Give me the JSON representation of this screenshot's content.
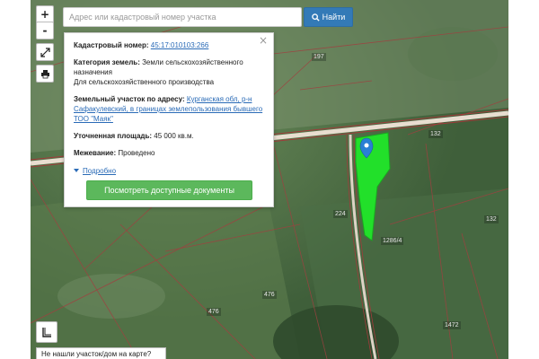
{
  "search": {
    "placeholder": "Адрес или кадастровый номер участка",
    "button_label": "Найти"
  },
  "zoom": {
    "in_label": "+",
    "out_label": "-"
  },
  "popup": {
    "cadastral_label": "Кадастровый номер:",
    "cadastral_value": "45:17:010103:266",
    "category_label": "Категория земель:",
    "category_value_1": "Земли сельскохозяйственного назначения",
    "category_value_2": "Для сельскохозяйственного производства",
    "address_label": "Земельный участок по адресу:",
    "address_value": "Курганская обл, р-н Сафакулевский, в границах землепользования бывшего ТОО \"Маяк\"",
    "area_label": "Уточненная площадь:",
    "area_value": "45 000 кв.м.",
    "survey_label": "Межевание:",
    "survey_value": "Проведено",
    "more_label": "Подробно",
    "docs_button": "Посмотреть доступные документы",
    "close_symbol": "×"
  },
  "map_labels": {
    "l197": "197",
    "l132a": "132",
    "l132b": "132",
    "l224": "224",
    "l1286": "1286/4",
    "l476a": "476",
    "l476b": "476",
    "l1472": "1472"
  },
  "bottom_prompt": "Не нашли участок/дом на карте?",
  "colors": {
    "parcel_fill": "#22e02a",
    "road": "#d9d0c8",
    "boundary": "#c0392b",
    "accent_blue": "#337ab7",
    "accent_green": "#5cb85c"
  }
}
